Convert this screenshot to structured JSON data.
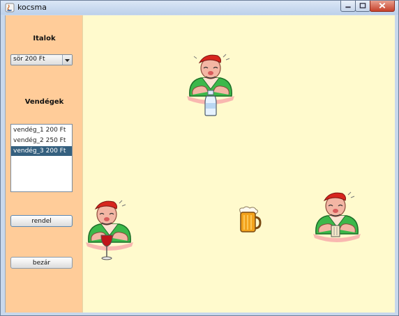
{
  "window": {
    "title": "kocsma"
  },
  "sidebar": {
    "drinks_label": "Italok",
    "drink_selected": "sör 200 Ft",
    "guests_label": "Vendégek",
    "guests": [
      {
        "label": "vendég_1 200 Ft",
        "selected": false
      },
      {
        "label": "vendég_2 250 Ft",
        "selected": false
      },
      {
        "label": "vendég_3 200 Ft",
        "selected": true
      }
    ],
    "order_button": "rendel",
    "close_button": "bezár"
  },
  "scene": {
    "guests": [
      {
        "name": "guest-with-water",
        "drink": "water-bottle-icon"
      },
      {
        "name": "guest-with-wine",
        "drink": "wine-glass-icon"
      },
      {
        "name": "guest-with-beer-glass",
        "drink": "beer-glass-icon"
      }
    ],
    "served_drink": "beer-mug-icon"
  },
  "colors": {
    "sidebar_bg": "#ffcc99",
    "canvas_bg": "#fffacd",
    "selection": "#35607f"
  }
}
